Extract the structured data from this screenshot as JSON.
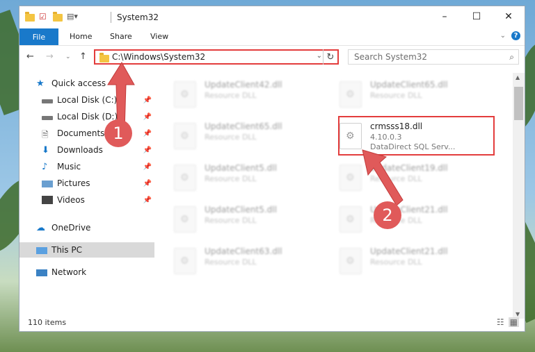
{
  "window": {
    "title": "System32",
    "controls": [
      "minimize",
      "maximize",
      "close"
    ]
  },
  "ribbon": {
    "file_label": "File",
    "tabs": [
      "Home",
      "Share",
      "View"
    ]
  },
  "address": {
    "path": "C:\\Windows\\System32",
    "search_placeholder": "Search System32"
  },
  "sidebar": {
    "items": [
      {
        "label": "Quick access",
        "icon": "star-icon",
        "pinned": false
      },
      {
        "label": "Local Disk (C:)",
        "icon": "drive-icon",
        "pinned": true
      },
      {
        "label": "Local Disk (D:)",
        "icon": "drive-icon",
        "pinned": true
      },
      {
        "label": "Documents",
        "icon": "document-icon",
        "pinned": true
      },
      {
        "label": "Downloads",
        "icon": "download-icon",
        "pinned": true
      },
      {
        "label": "Music",
        "icon": "music-icon",
        "pinned": true
      },
      {
        "label": "Pictures",
        "icon": "pictures-icon",
        "pinned": true
      },
      {
        "label": "Videos",
        "icon": "video-icon",
        "pinned": true
      },
      {
        "label": "OneDrive",
        "icon": "cloud-icon",
        "pinned": false
      },
      {
        "label": "This PC",
        "icon": "computer-icon",
        "pinned": false
      },
      {
        "label": "Network",
        "icon": "network-icon",
        "pinned": false
      }
    ]
  },
  "files": [
    {
      "name": "UpdateClient42.dll",
      "type": "Resource DLL"
    },
    {
      "name": "UpdateClient65.dll",
      "type": "Resource DLL"
    },
    {
      "name": "UpdateClient65.dll",
      "type": "Resource DLL"
    },
    {
      "name": "crmsss18.dll",
      "version": "4.10.0.3",
      "company": "DataDirect SQL Serv..."
    },
    {
      "name": "UpdateClient5.dll",
      "type": "Resource DLL"
    },
    {
      "name": "UpdateClient19.dll",
      "type": "Resource DLL"
    },
    {
      "name": "UpdateClient5.dll",
      "type": "Resource DLL"
    },
    {
      "name": "UpdateClient21.dll",
      "type": "Resource DLL"
    },
    {
      "name": "UpdateClient63.dll",
      "type": "Resource DLL"
    },
    {
      "name": "UpdateClient21.dll",
      "type": "Resource DLL"
    }
  ],
  "status": {
    "item_count": "110 items"
  },
  "annotations": {
    "step1": "1",
    "step2": "2",
    "color": "#e33c3c"
  }
}
